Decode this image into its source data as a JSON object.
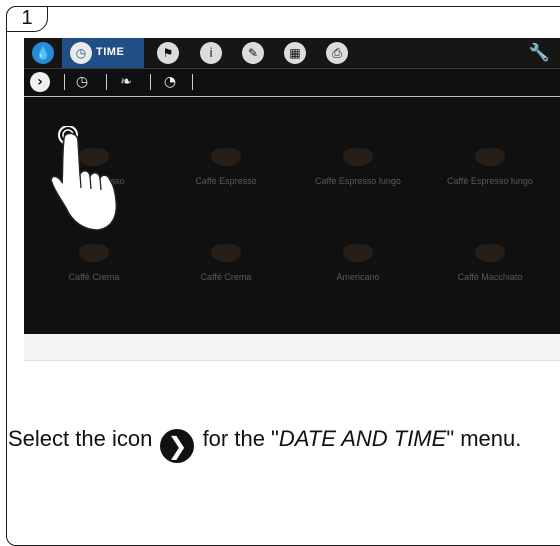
{
  "step_number": "1",
  "topbar": {
    "time_label": "TIME",
    "icons": [
      "water-drop-icon",
      "clock-icon",
      "flag-icon",
      "info-icon",
      "pencil-icon",
      "calculator-icon",
      "printer-icon",
      "wrench-icon"
    ]
  },
  "subbar": {
    "icons": [
      "date-and-time-icon",
      "timer-icon",
      "energy-save-icon",
      "descale-timer-icon"
    ]
  },
  "products": [
    {
      "label": "Caffè Espresso"
    },
    {
      "label": "Caffè Espresso"
    },
    {
      "label": "Caffè Espresso lungo"
    },
    {
      "label": "Caffè Espresso lungo"
    },
    {
      "label": "Caffè Crema"
    },
    {
      "label": "Caffè Crema"
    },
    {
      "label": "Americano"
    },
    {
      "label": "Caffè Macchiato"
    }
  ],
  "instruction": {
    "before": "Select the icon",
    "after": "for the \"",
    "menu": "DATE AND TIME",
    "end": "\" menu."
  }
}
